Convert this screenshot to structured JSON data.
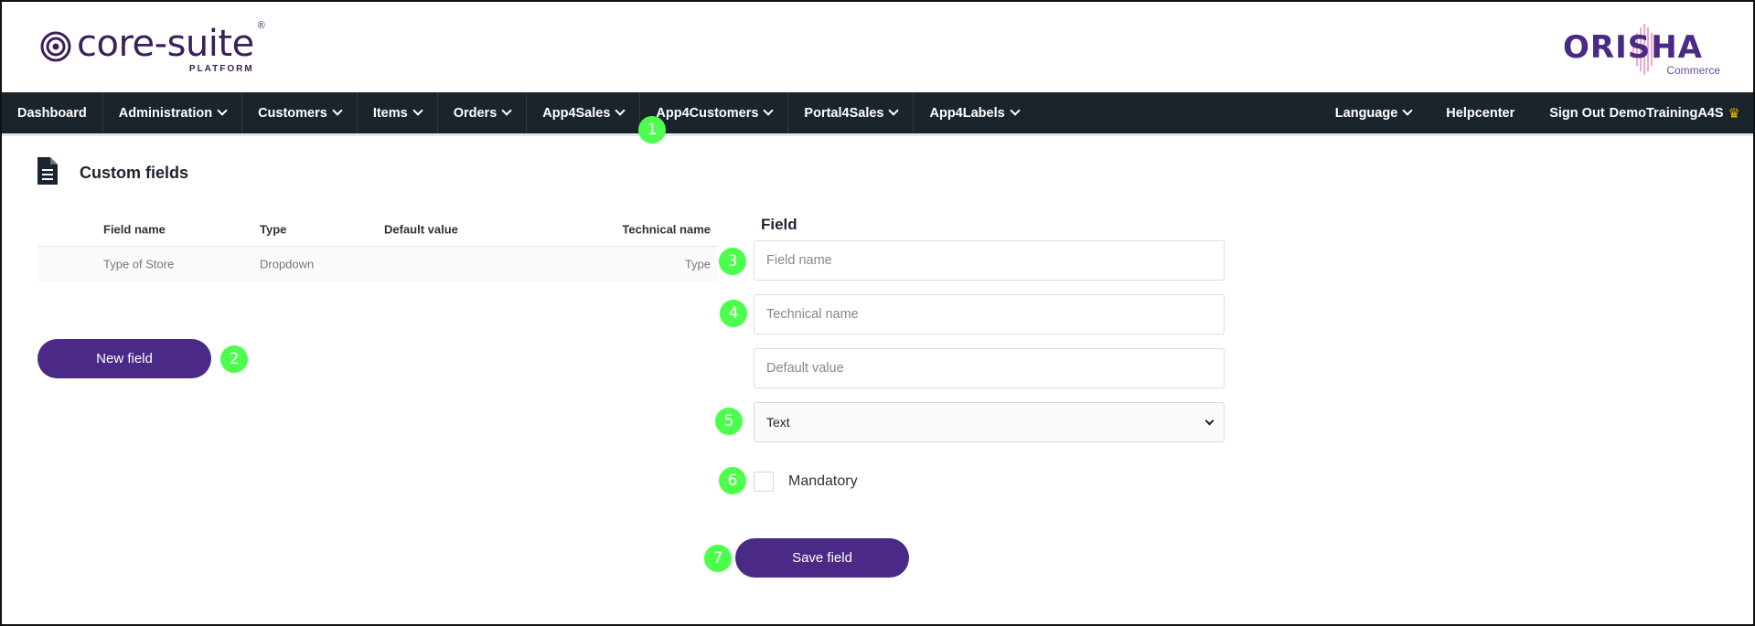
{
  "header": {
    "brand_main": "core-suite",
    "brand_reg": "®",
    "brand_sub": "PLATFORM",
    "partner_name": "ORISHA",
    "partner_sub": "Commerce"
  },
  "nav": {
    "items": [
      {
        "label": "Dashboard",
        "dropdown": false
      },
      {
        "label": "Administration",
        "dropdown": true
      },
      {
        "label": "Customers",
        "dropdown": true
      },
      {
        "label": "Items",
        "dropdown": true
      },
      {
        "label": "Orders",
        "dropdown": true
      },
      {
        "label": "App4Sales",
        "dropdown": true
      },
      {
        "label": "App4Customers",
        "dropdown": true
      },
      {
        "label": "Portal4Sales",
        "dropdown": true
      },
      {
        "label": "App4Labels",
        "dropdown": true
      }
    ],
    "right": {
      "language": "Language",
      "helpcenter": "Helpcenter",
      "signout": "Sign Out",
      "user": "DemoTrainingA4S",
      "crown_icon": "crown-icon"
    }
  },
  "page": {
    "title": "Custom fields",
    "icon": "document-icon"
  },
  "table": {
    "headers": [
      "Field name",
      "Type",
      "Default value",
      "Technical name"
    ],
    "rows": [
      [
        "Type of Store",
        "Dropdown",
        "",
        "Type"
      ]
    ]
  },
  "actions": {
    "new_field": "New field",
    "save_field": "Save field"
  },
  "form": {
    "title": "Field",
    "field_name_placeholder": "Field name",
    "technical_name_placeholder": "Technical name",
    "default_value_placeholder": "Default value",
    "type_selected": "Text",
    "mandatory_label": "Mandatory",
    "mandatory_checked": false
  },
  "badges": [
    "1",
    "2",
    "3",
    "4",
    "5",
    "6",
    "7"
  ],
  "colors": {
    "nav_bg": "#1c242b",
    "primary": "#4a2a86",
    "badge": "#4cff4c",
    "brand": "#3b1f5c"
  }
}
